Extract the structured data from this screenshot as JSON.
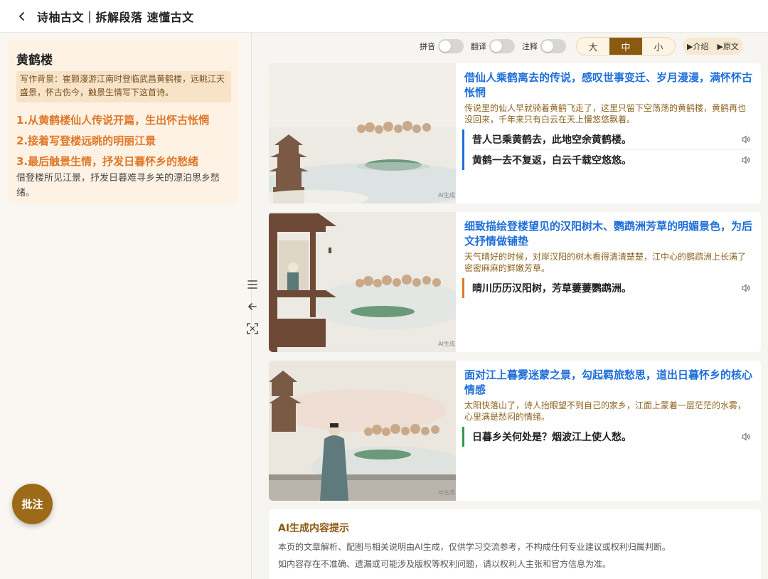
{
  "header": {
    "title": "诗柚古文｜拆解段落 速懂古文"
  },
  "left": {
    "poem_title": "黄鹤楼",
    "background": "写作背景：崔颢漫游江南时登临武昌黄鹤楼，远眺江天盛景，怀古伤今，触景生情写下这首诗。",
    "outline": [
      "1.从黄鹤楼仙人传说开篇，生出怀古怅惘",
      "2.接着写登楼远眺的明丽江景",
      "3.最后触景生情，抒发日暮怀乡的愁绪"
    ],
    "summary": "借登楼所见江景，抒发日暮难寻乡关的漂泊思乡愁绪。",
    "annotate_label": "批注"
  },
  "controls": {
    "pinyin": "拼音",
    "translate": "翻译",
    "notes": "注释",
    "sizes": [
      "大",
      "中",
      "小"
    ],
    "active_size": "中",
    "intro": "▶介绍",
    "original": "▶原文"
  },
  "sections": [
    {
      "title": "借仙人乘鹤离去的传说，感叹世事变迁、岁月漫漫，满怀怀古怅惘",
      "desc": "传说里的仙人早就骑着黄鹤飞走了，这里只留下空荡荡的黄鹤楼，黄鹤再也没回来，千年来只有白云在天上慢悠悠飘着。",
      "lines": [
        "昔人已乘黄鹤去，此地空余黄鹤楼。",
        "黄鹤一去不复返，白云千载空悠悠。"
      ],
      "accent": "#1f6fd8",
      "image_label": "AI生成"
    },
    {
      "title": "细致描绘登楼望见的汉阳树木、鹦鹉洲芳草的明媚景色，为后文抒情做铺垫",
      "desc": "天气晴好的时候，对岸汉阳的树木看得清清楚楚，江中心的鹦鹉洲上长满了密密麻麻的鲜嫩芳草。",
      "lines": [
        "晴川历历汉阳树，芳草萋萋鹦鹉洲。"
      ],
      "accent": "#e07a26",
      "image_label": "AI生成"
    },
    {
      "title": "面对江上暮雾迷蒙之景，勾起羁旅愁思，道出日暮怀乡的核心情感",
      "desc": "太阳快落山了，诗人抬眼望不到自己的家乡，江面上蒙着一层茫茫的水雾，心里满是愁闷的情绪。",
      "lines": [
        "日暮乡关何处是？烟波江上使人愁。"
      ],
      "accent": "#2f9a4a",
      "image_label": "AI生成"
    }
  ],
  "notice": {
    "title": "AI生成内容提示",
    "lines": [
      "本页的文章解析、配图与相关说明由AI生成，仅供学习交流参考，不构成任何专业建议或权利归属判断。",
      "如内容存在不准确、遗漏或可能涉及版权等权利问题，请以权利人主张和官方信息为准。"
    ]
  },
  "icons": [
    "chevron-left-icon",
    "menu-icon",
    "arrow-left-icon",
    "fullscreen-icon",
    "speaker-icon"
  ],
  "colors": {
    "brand": "#8a5a10",
    "orange": "#e0782a",
    "blue": "#1f6fd8",
    "green": "#2f9a4a"
  }
}
